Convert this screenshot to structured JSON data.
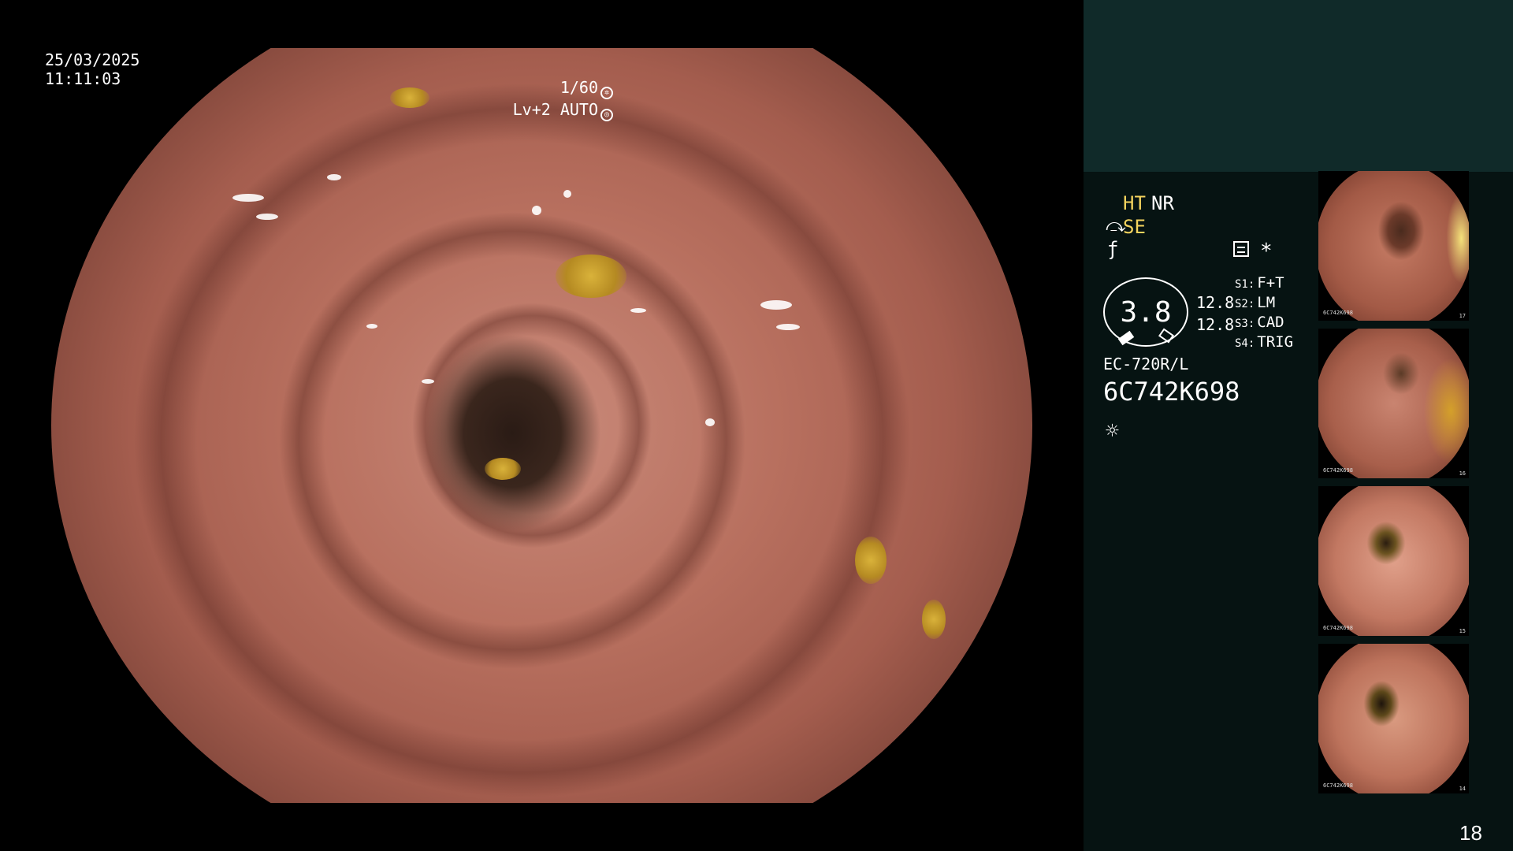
{
  "osd": {
    "date": "25/03/2025",
    "time": "11:11:03",
    "shutter": "1/60",
    "level": "Lv+2 AUTO"
  },
  "panel": {
    "mode_ht": "HT",
    "mode_nr": "NR",
    "mode_se": "SE",
    "gauge_value": "3.8",
    "value_1": "12.8",
    "value_2": "12.8",
    "switches": [
      {
        "key": "S1:",
        "value": "F+T"
      },
      {
        "key": "S2:",
        "value": "LM"
      },
      {
        "key": "S3:",
        "value": "CAD"
      },
      {
        "key": "S4:",
        "value": "TRIG"
      }
    ],
    "scope_model": "EC-720R/L",
    "scope_serial": "6C742K698"
  },
  "thumbnails": [
    {
      "serial": "6C742K698",
      "number": "17"
    },
    {
      "serial": "6C742K698",
      "number": "16"
    },
    {
      "serial": "6C742K698",
      "number": "15"
    },
    {
      "serial": "6C742K698",
      "number": "14"
    }
  ],
  "page_number": "18",
  "icons": [
    "shutter-icon",
    "auto-iris-icon",
    "curve-icon",
    "f-icon",
    "memo-icon",
    "star-icon",
    "light-icon"
  ],
  "colors": {
    "panel_bg": "#061312",
    "panel_top": "#102a29",
    "mode_accent": "#f4d35e"
  }
}
